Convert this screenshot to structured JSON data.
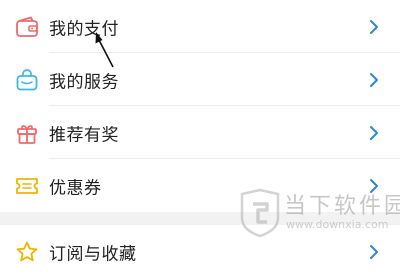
{
  "menu": {
    "items": [
      {
        "label": "我的支付",
        "icon": "wallet-icon",
        "icon_color": "#ef6a6a"
      },
      {
        "label": "我的服务",
        "icon": "shopping-bag-icon",
        "icon_color": "#3cb8e6"
      },
      {
        "label": "推荐有奖",
        "icon": "gift-icon",
        "icon_color": "#ef6a6a"
      },
      {
        "label": "优惠券",
        "icon": "coupon-icon",
        "icon_color": "#f0b400"
      }
    ],
    "partial_item": {
      "label": "订阅与收藏",
      "icon": "star-icon",
      "icon_color": "#f0b400"
    },
    "chevron_color": "#2f84d6"
  },
  "watermark": {
    "title": "当下软件园",
    "url": "www.downxia.com"
  }
}
